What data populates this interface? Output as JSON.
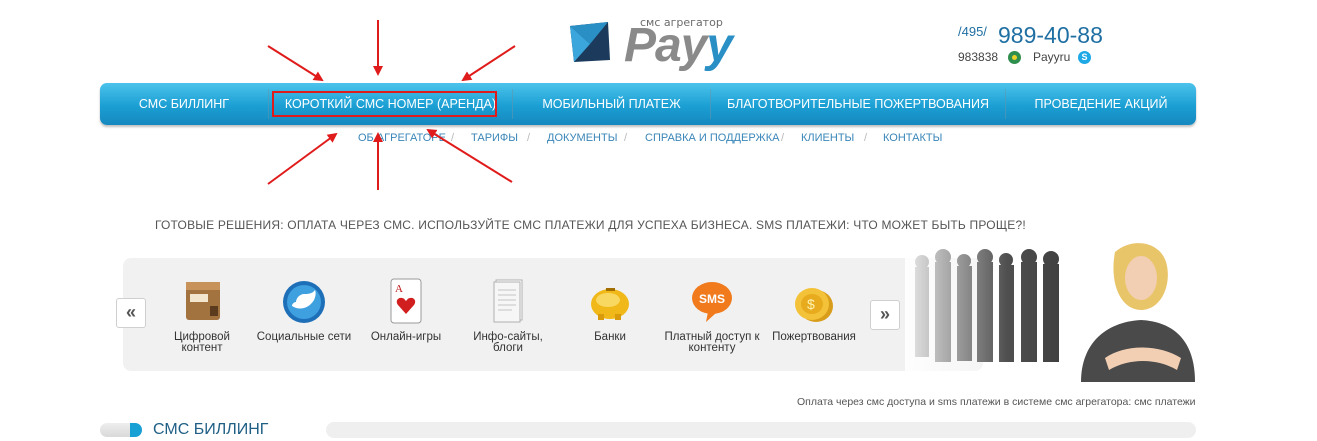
{
  "header": {
    "logo_tag": "смс агрегатор",
    "logo_text_main": "Pay",
    "logo_text_accent": "y",
    "phone_code": "/495/",
    "phone_number": "989-40-88",
    "icq_number": "983838",
    "skype_name": "Payyru",
    "accent_color": "#1b9fd3"
  },
  "main_nav": {
    "items": [
      {
        "label": "СМС БИЛЛИНГ"
      },
      {
        "label": "КОРОТКИЙ СМС НОМЕР (АРЕНДА)"
      },
      {
        "label": "МОБИЛЬНЫЙ ПЛАТЕЖ"
      },
      {
        "label": "БЛАГОТВОРИТЕЛЬНЫЕ ПОЖЕРТВОВАНИЯ"
      },
      {
        "label": "ПРОВЕДЕНИЕ АКЦИЙ"
      }
    ]
  },
  "sub_nav": {
    "items": [
      {
        "label": "ОБ АГРЕГАТОРЕ"
      },
      {
        "label": "ТАРИФЫ"
      },
      {
        "label": "ДОКУМЕНТЫ"
      },
      {
        "label": "СПРАВКА И ПОДДЕРЖКА"
      },
      {
        "label": "КЛИЕНТЫ"
      },
      {
        "label": "КОНТАКТЫ"
      }
    ],
    "separator": "/"
  },
  "tagline": "ГОТОВЫЕ РЕШЕНИЯ: ОПЛАТА ЧЕРЕЗ СМС. ИСПОЛЬЗУЙТЕ СМС ПЛАТЕЖИ ДЛЯ УСПЕХА БИЗНЕСА. SMS ПЛАТЕЖИ: ЧТО МОЖЕТ БЫТЬ ПРОЩЕ?!",
  "carousel": {
    "prev_label": "«",
    "next_label": "»",
    "items": [
      {
        "label": "Цифровой контент",
        "icon": "package-icon"
      },
      {
        "label": "Социальные сети",
        "icon": "twitter-bird-icon"
      },
      {
        "label": "Онлайн-игры",
        "icon": "playing-card-icon"
      },
      {
        "label": "Инфо-сайты, блоги",
        "icon": "document-icon"
      },
      {
        "label": "Банки",
        "icon": "piggy-bank-icon"
      },
      {
        "label": "Платный доступ к контенту",
        "icon": "sms-bubble-icon"
      },
      {
        "label": "Пожертвования",
        "icon": "coins-icon"
      }
    ],
    "sms_bubble_text": "SMS"
  },
  "caption": "Оплата через смс доступа и sms платежи в системе смс агрегатора: смс платежи",
  "section": {
    "title": "СМС БИЛЛИНГ"
  },
  "annotation_color": "#e01b1b"
}
